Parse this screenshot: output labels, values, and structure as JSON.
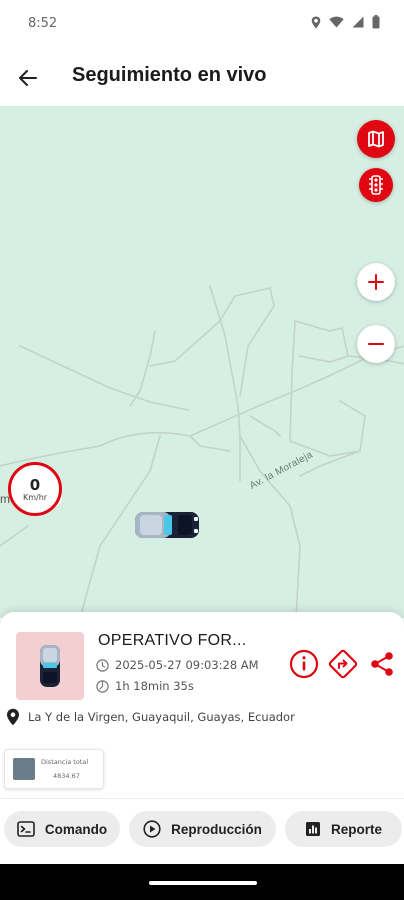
{
  "status_bar": {
    "time": "8:52"
  },
  "app_bar": {
    "title": "Seguimiento en vivo"
  },
  "map": {
    "road_label": "Av. la Moraleja",
    "poi_label": "m MX",
    "speed": {
      "value": "0",
      "unit": "Km/hr"
    }
  },
  "vehicle": {
    "name": "OPERATIVO FOR...",
    "datetime": "2025-05-27 09:03:28 AM",
    "duration": "1h 18min 35s",
    "address": "La Y de la Virgen, Guayaquil, Guayas, Ecuador"
  },
  "stats": {
    "distance_label": "Distancia total",
    "distance_value": "4834.67"
  },
  "actions": {
    "command": "Comando",
    "playback": "Reproducción",
    "report": "Reporte"
  },
  "colors": {
    "accent": "#e00612",
    "map_bg": "#d6efe3"
  },
  "icons": [
    "back-arrow-icon",
    "map-icon",
    "traffic-light-icon",
    "zoom-in-icon",
    "zoom-out-icon",
    "info-icon",
    "directions-icon",
    "share-icon",
    "clock-icon",
    "timer-icon",
    "location-pin-icon",
    "terminal-icon",
    "play-icon",
    "report-icon"
  ]
}
